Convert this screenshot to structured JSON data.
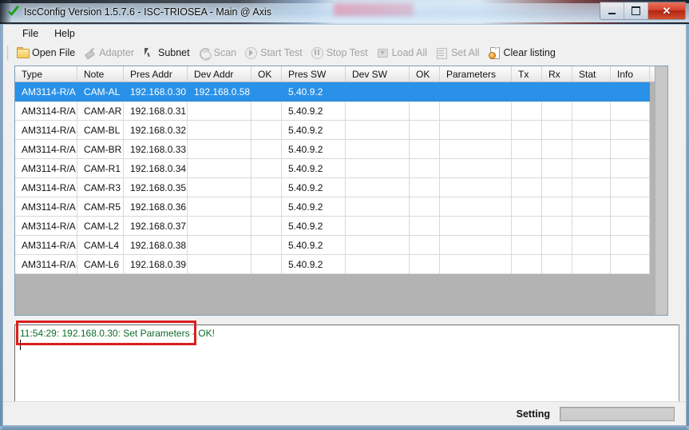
{
  "window": {
    "title": "IscConfig Version 1.5.7.6 - ISC-TRIOSEA - Main @ Axis",
    "app_icon": "green-check-icon",
    "minimize_label": "",
    "maximize_label": "",
    "close_label": "✕"
  },
  "menubar": {
    "items": [
      {
        "label": "File"
      },
      {
        "label": "Help"
      }
    ]
  },
  "toolbar": {
    "buttons": [
      {
        "label": "Open File",
        "icon": "folder-icon",
        "enabled": true
      },
      {
        "label": "Adapter",
        "icon": "plug-icon",
        "enabled": false
      },
      {
        "label": "Subnet",
        "icon": "cursor-icon",
        "enabled": true
      },
      {
        "label": "Scan",
        "icon": "refresh-icon",
        "enabled": false
      },
      {
        "label": "Start Test",
        "icon": "play-icon",
        "enabled": false
      },
      {
        "label": "Stop Test",
        "icon": "pause-icon",
        "enabled": false
      },
      {
        "label": "Load All",
        "icon": "download-box-icon",
        "enabled": false
      },
      {
        "label": "Set All",
        "icon": "set-all-icon",
        "enabled": false
      },
      {
        "label": "Clear listing",
        "icon": "page-clear-icon",
        "enabled": true
      }
    ]
  },
  "grid": {
    "columns": [
      {
        "label": "Type",
        "width": 78
      },
      {
        "label": "Note",
        "width": 58
      },
      {
        "label": "Pres Addr",
        "width": 80
      },
      {
        "label": "Dev Addr",
        "width": 80
      },
      {
        "label": "OK",
        "width": 38
      },
      {
        "label": "Pres SW",
        "width": 80
      },
      {
        "label": "Dev SW",
        "width": 80
      },
      {
        "label": "OK",
        "width": 38
      },
      {
        "label": "Parameters",
        "width": 90
      },
      {
        "label": "Tx",
        "width": 38
      },
      {
        "label": "Rx",
        "width": 38
      },
      {
        "label": "Stat",
        "width": 48
      },
      {
        "label": "Info",
        "width": 49
      }
    ],
    "rows": [
      {
        "selected": true,
        "cells": [
          "AM3114-R/A",
          "CAM-AL",
          "192.168.0.30",
          "192.168.0.58",
          "",
          "5.40.9.2",
          "",
          "",
          "",
          "",
          "",
          "",
          ""
        ]
      },
      {
        "selected": false,
        "cells": [
          "AM3114-R/A",
          "CAM-AR",
          "192.168.0.31",
          "",
          "",
          "5.40.9.2",
          "",
          "",
          "",
          "",
          "",
          "",
          ""
        ]
      },
      {
        "selected": false,
        "cells": [
          "AM3114-R/A",
          "CAM-BL",
          "192.168.0.32",
          "",
          "",
          "5.40.9.2",
          "",
          "",
          "",
          "",
          "",
          "",
          ""
        ]
      },
      {
        "selected": false,
        "cells": [
          "AM3114-R/A",
          "CAM-BR",
          "192.168.0.33",
          "",
          "",
          "5.40.9.2",
          "",
          "",
          "",
          "",
          "",
          "",
          ""
        ]
      },
      {
        "selected": false,
        "cells": [
          "AM3114-R/A",
          "CAM-R1",
          "192.168.0.34",
          "",
          "",
          "5.40.9.2",
          "",
          "",
          "",
          "",
          "",
          "",
          ""
        ]
      },
      {
        "selected": false,
        "cells": [
          "AM3114-R/A",
          "CAM-R3",
          "192.168.0.35",
          "",
          "",
          "5.40.9.2",
          "",
          "",
          "",
          "",
          "",
          "",
          ""
        ]
      },
      {
        "selected": false,
        "cells": [
          "AM3114-R/A",
          "CAM-R5",
          "192.168.0.36",
          "",
          "",
          "5.40.9.2",
          "",
          "",
          "",
          "",
          "",
          "",
          ""
        ]
      },
      {
        "selected": false,
        "cells": [
          "AM3114-R/A",
          "CAM-L2",
          "192.168.0.37",
          "",
          "",
          "5.40.9.2",
          "",
          "",
          "",
          "",
          "",
          "",
          ""
        ]
      },
      {
        "selected": false,
        "cells": [
          "AM3114-R/A",
          "CAM-L4",
          "192.168.0.38",
          "",
          "",
          "5.40.9.2",
          "",
          "",
          "",
          "",
          "",
          "",
          ""
        ]
      },
      {
        "selected": false,
        "cells": [
          "AM3114-R/A",
          "CAM-L6",
          "192.168.0.39",
          "",
          "",
          "5.40.9.2",
          "",
          "",
          "",
          "",
          "",
          "",
          ""
        ]
      }
    ],
    "selection_color": "#2a91e8"
  },
  "log": {
    "lines": [
      "11:54:29: 192.168.0.30: Set Parameters - OK!"
    ],
    "text_color": "#0f6b2a"
  },
  "annotation": {
    "type": "red-rectangle-highlight",
    "color": "#d91f1f",
    "targets_log_line": "11:54:29: 192.168.0.30: Set Parameters - OK!"
  },
  "statusbar": {
    "label": "Setting",
    "progress_percent": 0
  }
}
